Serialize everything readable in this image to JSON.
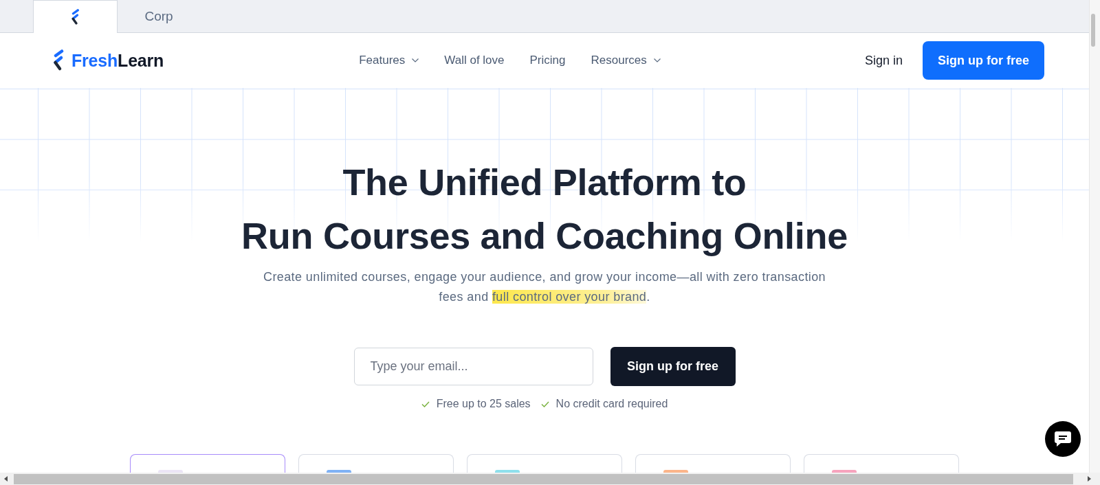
{
  "site_tabs": [
    {
      "kind": "logo",
      "selected": true
    },
    {
      "kind": "text",
      "label": "Corp",
      "selected": false
    }
  ],
  "header": {
    "logo": {
      "parts": [
        "Fresh",
        "Learn"
      ]
    },
    "nav": [
      {
        "label": "Features",
        "has_menu": true
      },
      {
        "label": "Wall of love",
        "has_menu": false
      },
      {
        "label": "Pricing",
        "has_menu": false
      },
      {
        "label": "Resources",
        "has_menu": true
      }
    ],
    "sign_in": "Sign in",
    "cta": "Sign up for free"
  },
  "hero": {
    "title_lines": [
      "The Unified Platform to",
      "Run Courses and Coaching Online"
    ],
    "subtitle": [
      {
        "text": "Create unlimited courses, engage your audience, and grow your income—all with zero transaction fees and ",
        "highlighted": false
      },
      {
        "text": "full control over your brand",
        "highlighted": true
      },
      {
        "text": ".",
        "highlighted": false
      }
    ],
    "email": {
      "placeholder": "Type your email..."
    },
    "submit": "Sign up for free",
    "perks": [
      "Free up to 25 sales",
      "No credit card required"
    ]
  },
  "cards": [
    {
      "selected": true,
      "color": "#ebe5f6"
    },
    {
      "selected": false,
      "color": "#7fb2f5"
    },
    {
      "selected": false,
      "color": "#8ee0ec"
    },
    {
      "selected": false,
      "color": "#fcb58a"
    },
    {
      "selected": false,
      "color": "#f7a3bd"
    }
  ]
}
